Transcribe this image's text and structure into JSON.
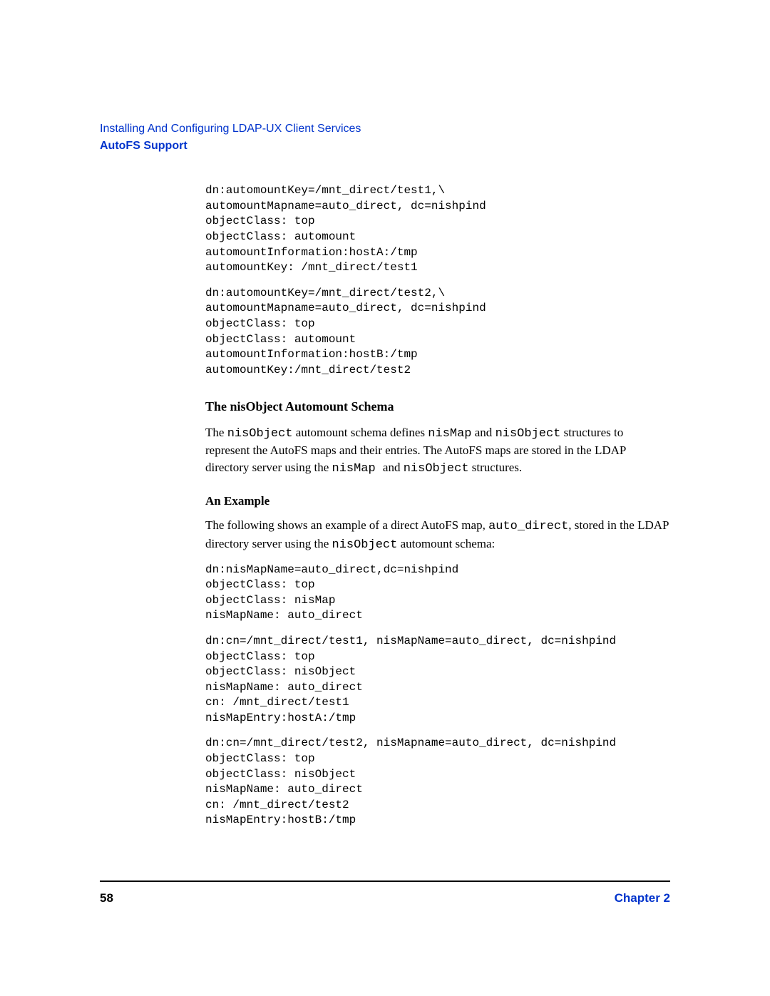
{
  "header": {
    "chapter_title": "Installing And Configuring LDAP-UX Client Services",
    "section_title": "AutoFS Support"
  },
  "code1": "dn:automountKey=/mnt_direct/test1,\\\nautomountMapname=auto_direct, dc=nishpind\nobjectClass: top\nobjectClass: automount\nautomountInformation:hostA:/tmp\nautomountKey: /mnt_direct/test1",
  "code2": "dn:automountKey=/mnt_direct/test2,\\\nautomountMapname=auto_direct, dc=nishpind\nobjectClass: top\nobjectClass: automount\nautomountInformation:hostB:/tmp\nautomountKey:/mnt_direct/test2",
  "heading1": "The nisObject Automount Schema",
  "para1": {
    "t1": "The ",
    "m1": "nisObject",
    "t2": " automount schema defines ",
    "m2": "nisMap",
    "t3": " and ",
    "m3": "nisObject",
    "t4": " structures to represent the AutoFS maps and their entries. The AutoFS maps are stored in the LDAP directory server using the ",
    "m4": "nisMap ",
    "t5": "and ",
    "m5": "nisObject",
    "t6": " structures."
  },
  "heading2": "An Example",
  "para2": {
    "t1": "The following shows an example of a direct AutoFS map, ",
    "m1": "auto_direct",
    "t2": ", stored in the LDAP directory server using the ",
    "m2": "nisObject",
    "t3": " automount schema:"
  },
  "code3": "dn:nisMapName=auto_direct,dc=nishpind\nobjectClass: top\nobjectClass: nisMap\nnisMapName: auto_direct",
  "code4": "dn:cn=/mnt_direct/test1, nisMapName=auto_direct, dc=nishpind\nobjectClass: top\nobjectClass: nisObject\nnisMapName: auto_direct\ncn: /mnt_direct/test1\nnisMapEntry:hostA:/tmp",
  "code5": "dn:cn=/mnt_direct/test2, nisMapname=auto_direct, dc=nishpind\nobjectClass: top\nobjectClass: nisObject\nnisMapName: auto_direct\ncn: /mnt_direct/test2\nnisMapEntry:hostB:/tmp",
  "footer": {
    "page": "58",
    "chapter": "Chapter 2"
  }
}
